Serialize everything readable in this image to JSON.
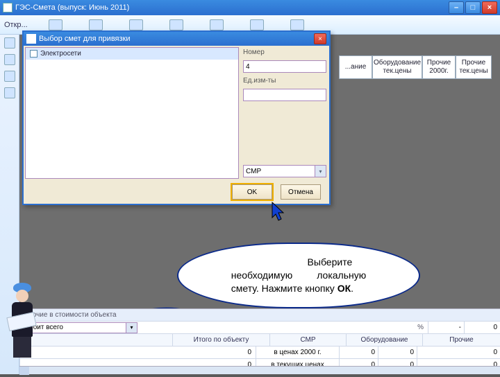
{
  "window": {
    "title": "ГЭС-Смета (выпуск: Июнь 2011)"
  },
  "toolbar": {
    "open_label": "Откр..."
  },
  "headers": {
    "h1": "...ание",
    "h2": "Оборудование тек.цены",
    "h3": "Прочие 2000г.",
    "h4": "Прочие тек.цены"
  },
  "dialog": {
    "title": "Выбор смет для привязки",
    "item1": "Электросети",
    "label_number": "Номер",
    "number_value": "4",
    "label_units": "Ед.изм-ты",
    "combo_label": "СМР",
    "ok": "OK",
    "cancel": "Отмена"
  },
  "bubble": {
    "text1": "Выберите",
    "text2": "необходимую",
    "text3": "локальную",
    "text4": "смету. Нажмите кнопку",
    "ok_bold": "ОК"
  },
  "bottom": {
    "heading": "Прочие в стоимости объекта",
    "combo_value": "Стоит всего",
    "percent_label": "%",
    "zero": "0",
    "col_total": "Итого по объекту",
    "col_smr": "СМР",
    "col_equip": "Оборудование",
    "col_other": "Прочие",
    "row1_label": "в ценах 2000 г.",
    "row2_label": "в текущих ценах",
    "val0": "0"
  }
}
